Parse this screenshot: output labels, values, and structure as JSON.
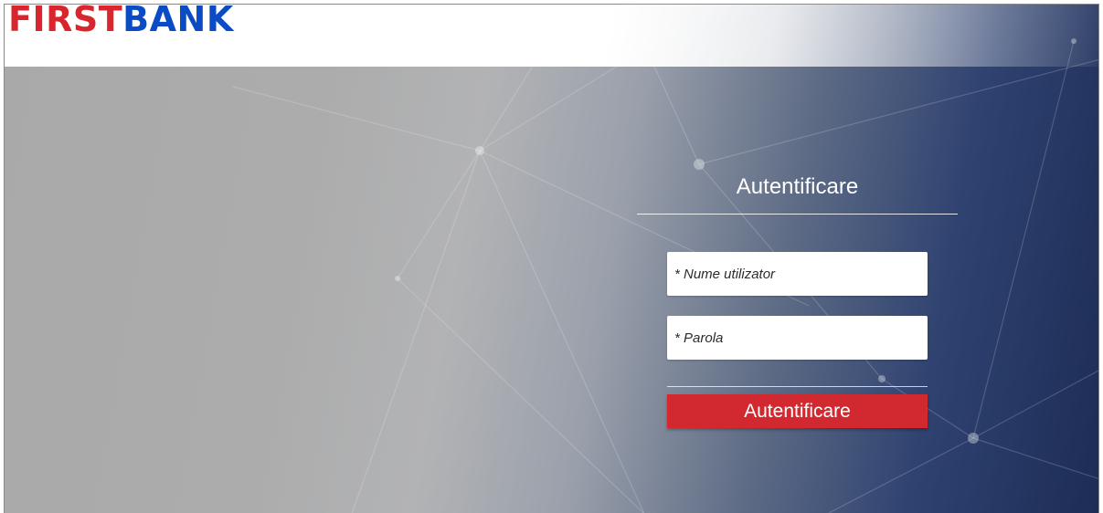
{
  "header": {
    "logo_red": "FIRST",
    "logo_blue": "BANK"
  },
  "login": {
    "title": "Autentificare",
    "username_placeholder": "* Nume utilizator",
    "password_placeholder": "* Parola",
    "submit_label": "Autentificare"
  },
  "colors": {
    "brand_blue": "#0b4cc4",
    "brand_red": "#d9262e",
    "button_red": "#d1292f"
  }
}
